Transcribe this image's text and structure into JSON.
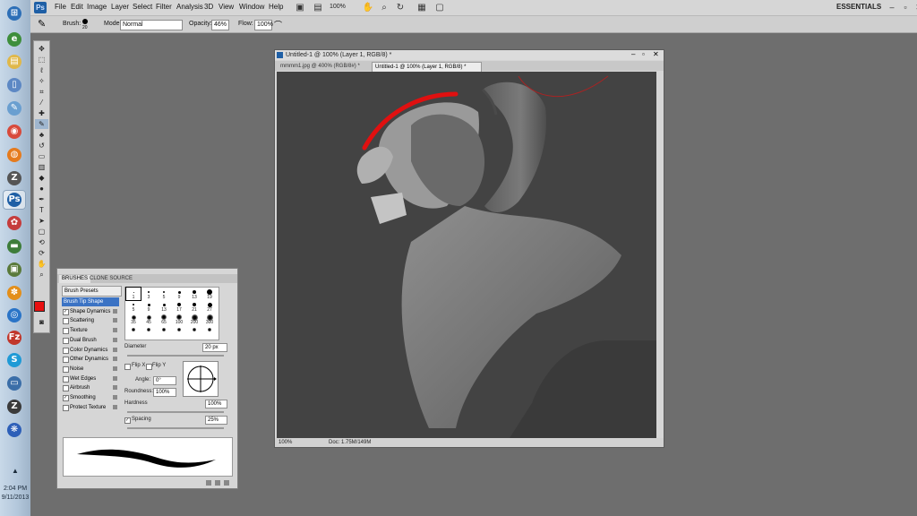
{
  "taskbar": {
    "icons": [
      {
        "name": "windows-start-icon",
        "color": "#2d6fb7",
        "glyph": "⊞"
      },
      {
        "name": "internet-explorer-icon",
        "color": "#3e8e3b",
        "glyph": "e"
      },
      {
        "name": "file-explorer-icon",
        "color": "#e0b84a",
        "glyph": "▤"
      },
      {
        "name": "document-icon",
        "color": "#5d88c4",
        "glyph": "▯"
      },
      {
        "name": "notes-icon",
        "color": "#6a9fd0",
        "glyph": "✎"
      },
      {
        "name": "chrome-icon",
        "color": "#d84a3b",
        "glyph": "◉"
      },
      {
        "name": "firefox-icon",
        "color": "#e57b1e",
        "glyph": "◍"
      },
      {
        "name": "zbrush-icon",
        "color": "#555555",
        "glyph": "Z"
      },
      {
        "name": "photoshop-icon",
        "color": "#1f5fa5",
        "glyph": "Ps"
      },
      {
        "name": "picasa-icon",
        "color": "#c53c3c",
        "glyph": "✿"
      },
      {
        "name": "book-icon",
        "color": "#3e7d3a",
        "glyph": "▬"
      },
      {
        "name": "media-icon",
        "color": "#5a7a3a",
        "glyph": "▣"
      },
      {
        "name": "flower-icon",
        "color": "#e38f1b",
        "glyph": "✽"
      },
      {
        "name": "globe-icon",
        "color": "#2a74c7",
        "glyph": "◎"
      },
      {
        "name": "filezilla-icon",
        "color": "#c1372b",
        "glyph": "Fz"
      },
      {
        "name": "skype-icon",
        "color": "#1f9ad6",
        "glyph": "S"
      },
      {
        "name": "remote-desktop-icon",
        "color": "#3b6ea8",
        "glyph": "▭"
      },
      {
        "name": "zbrush-alt-icon",
        "color": "#3b3b3b",
        "glyph": "Z"
      },
      {
        "name": "pinwheel-icon",
        "color": "#2d5fb8",
        "glyph": "❋"
      }
    ],
    "clock_time": "2:04 PM",
    "clock_date": "9/11/2013"
  },
  "menubar": {
    "logo": "Ps",
    "items": [
      "File",
      "Edit",
      "Image",
      "Layer",
      "Select",
      "Filter",
      "Analysis",
      "3D",
      "View",
      "Window",
      "Help"
    ],
    "zoom": "100%",
    "workspace": "ESSENTIALS"
  },
  "options": {
    "brush_label": "Brush:",
    "brush_size": "20",
    "mode_label": "Mode:",
    "mode_value": "Normal",
    "opacity_label": "Opacity:",
    "opacity_value": "46%",
    "flow_label": "Flow:",
    "flow_value": "100%"
  },
  "document": {
    "title": "Untitled-1 @ 100% (Layer 1, RGB/8) *",
    "tabs": [
      "mmmm1.jpg @ 400% (RGB/8#) *",
      "Untitled-1 @ 100% (Layer 1, RGB/8) *"
    ],
    "zoom": "100%",
    "doc_size": "Doc: 1.75M/149M",
    "colors": {
      "canvas": "#434343",
      "stroke": "#e01010"
    }
  },
  "brushes": {
    "tabs": [
      "BRUSHES",
      "CLONE SOURCE"
    ],
    "presets_button": "Brush Presets",
    "options": [
      {
        "label": "Brush Tip Shape",
        "checked": false,
        "selected": true
      },
      {
        "label": "Shape Dynamics",
        "checked": true,
        "selected": false
      },
      {
        "label": "Scattering",
        "checked": false,
        "selected": false
      },
      {
        "label": "Texture",
        "checked": false,
        "selected": false
      },
      {
        "label": "Dual Brush",
        "checked": false,
        "selected": false
      },
      {
        "label": "Color Dynamics",
        "checked": false,
        "selected": false
      },
      {
        "label": "Other Dynamics",
        "checked": false,
        "selected": false
      },
      {
        "label": "Noise",
        "checked": false,
        "selected": false
      },
      {
        "label": "Wet Edges",
        "checked": false,
        "selected": false
      },
      {
        "label": "Airbrush",
        "checked": false,
        "selected": false
      },
      {
        "label": "Smoothing",
        "checked": true,
        "selected": false
      },
      {
        "label": "Protect Texture",
        "checked": false,
        "selected": false
      }
    ],
    "tips": [
      "1",
      "3",
      "5",
      "9",
      "13",
      "19",
      "5",
      "9",
      "13",
      "17",
      "21",
      "27",
      "35",
      "45",
      "65",
      "100",
      "200",
      "300",
      "",
      "",
      "",
      "",
      "",
      ""
    ],
    "diameter_label": "Diameter",
    "diameter_value": "20 px",
    "flip_x": "Flip X",
    "flip_y": "Flip Y",
    "angle_label": "Angle:",
    "angle_value": "0°",
    "roundness_label": "Roundness:",
    "roundness_value": "100%",
    "hardness_label": "Hardness",
    "hardness_value": "100%",
    "spacing_label": "Spacing",
    "spacing_value": "25%"
  }
}
